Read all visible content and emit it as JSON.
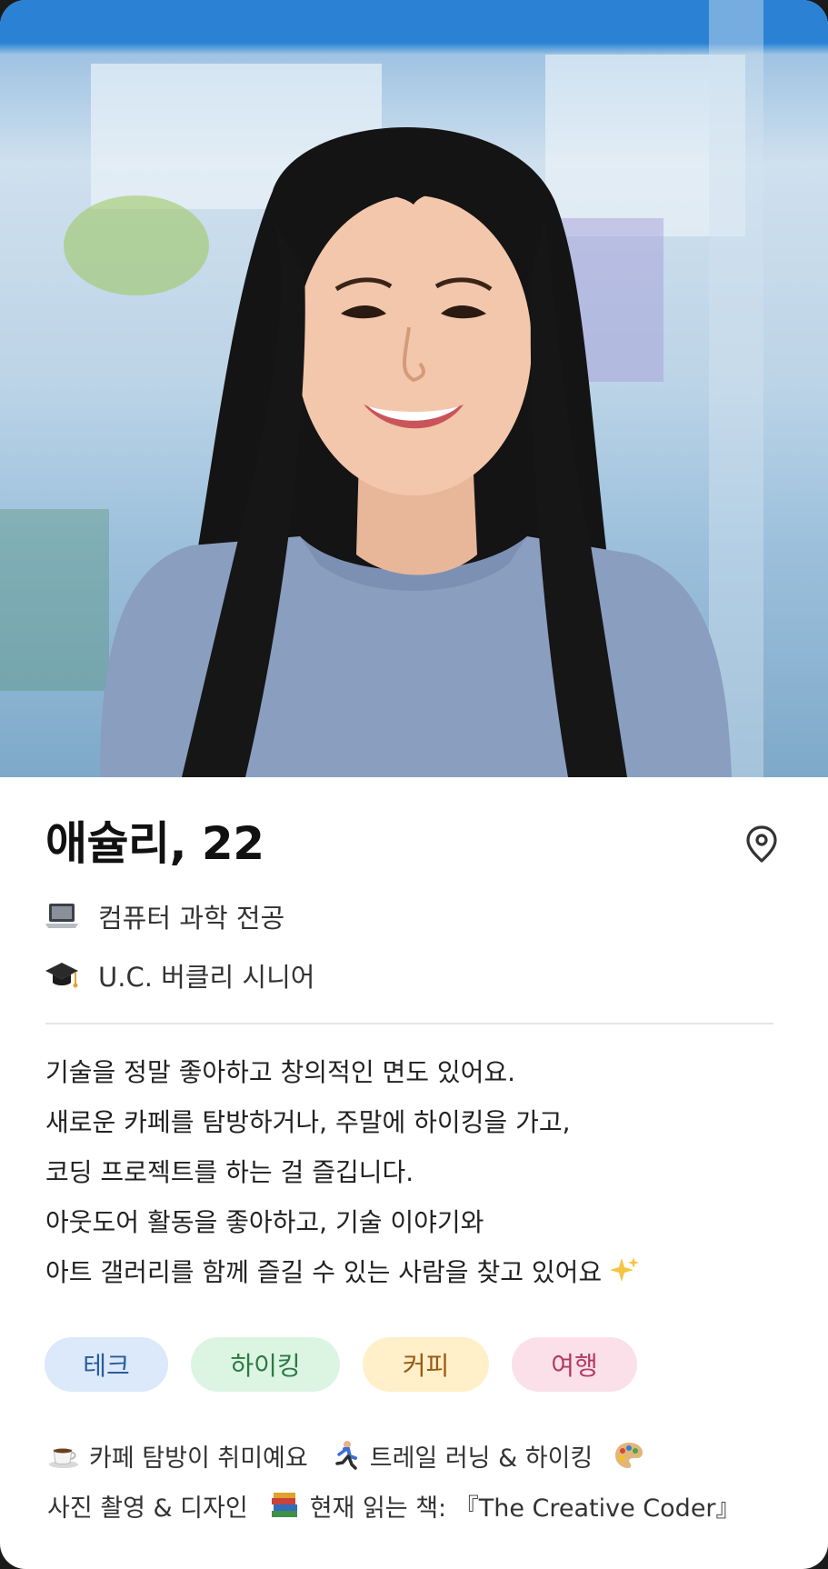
{
  "profile": {
    "name_age": "애슐리, 22",
    "major": "컴퓨터 과학 전공",
    "school": "U.C. 버클리 시니어",
    "major_icon": "laptop-emoji",
    "school_icon": "graduation-cap-emoji",
    "location_icon": "location-pin-icon"
  },
  "bio": [
    "기술을 정말 좋아하고 창의적인 면도 있어요.",
    "새로운 카페를 탐방하거나, 주말에 하이킹을 가고,",
    "코딩 프로젝트를 하는 걸 즐깁니다.",
    "아웃도어 활동을 좋아하고, 기술 이야기와",
    "아트 갤러리를 함께 즐길 수 있는 사람을 찾고 있어요"
  ],
  "tags": [
    "테크",
    "하이킹",
    "커피",
    "여행"
  ],
  "highlights": {
    "cafe": "카페 탐방이 취미예요",
    "trail": "트레일 러닝 & 하이킹",
    "photo": "사진 촬영 & 디자인",
    "book": "현재 읽는 책: 『The Creative Coder』"
  },
  "colors": {
    "tag_tech_bg": "#dbe9fb",
    "tag_hiking_bg": "#dbf5e2",
    "tag_coffee_bg": "#fff0c9",
    "tag_travel_bg": "#fbe0ea"
  }
}
